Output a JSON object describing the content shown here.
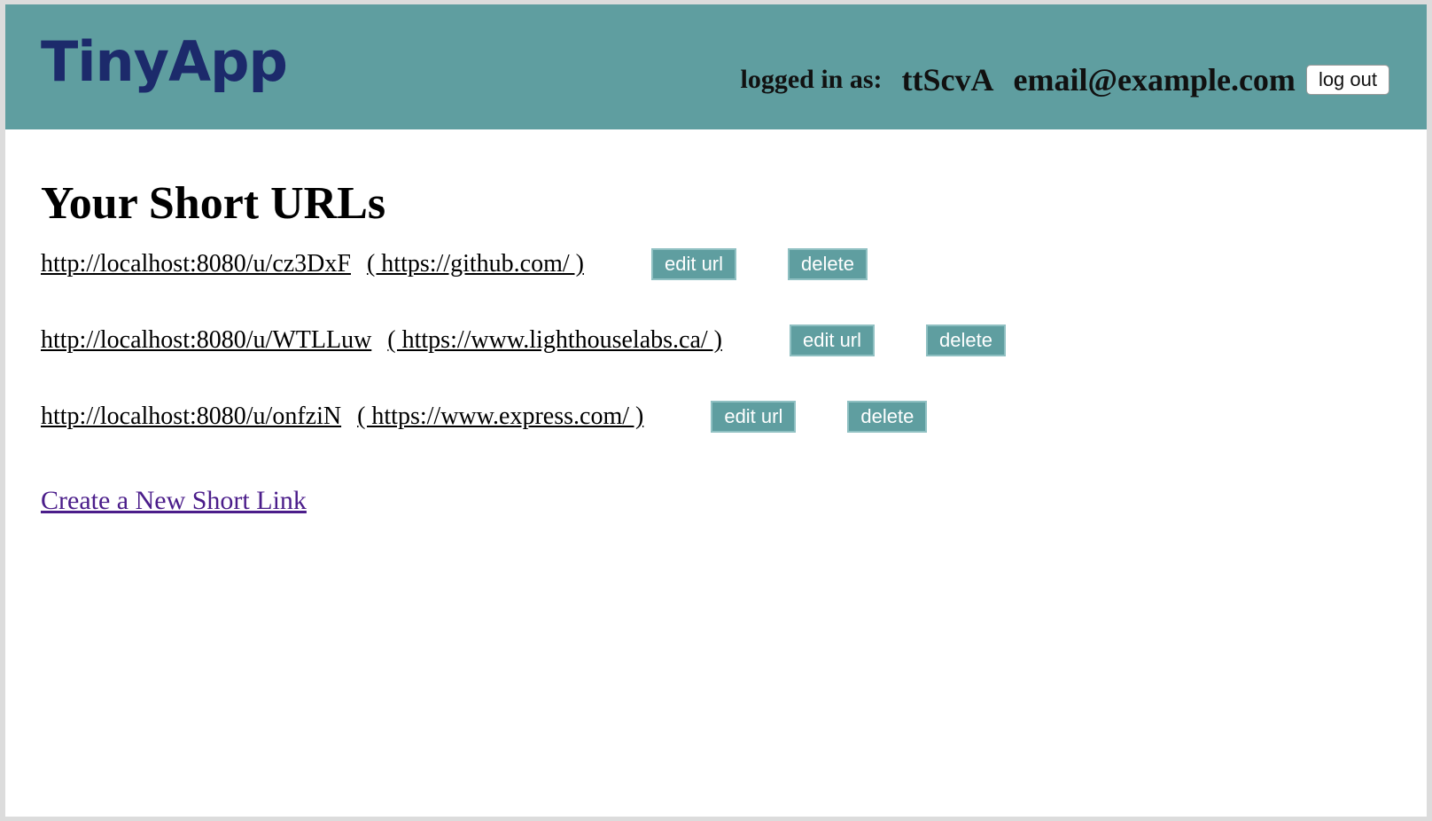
{
  "header": {
    "logo_text": "TinyApp",
    "logged_in_label": "logged in as:",
    "user_id": "ttScvA",
    "user_email": "email@example.com",
    "logout_label": "log out",
    "background_color": "#5f9ea0",
    "logo_color": "#1c2a6b"
  },
  "main": {
    "title": "Your Short URLs",
    "urls": [
      {
        "short_url": "http://localhost:8080/u/cz3DxF",
        "long_url": "( https://github.com/ )",
        "edit_label": "edit url",
        "delete_label": "delete"
      },
      {
        "short_url": "http://localhost:8080/u/WTLLuw",
        "long_url": "( https://www.lighthouselabs.ca/ )",
        "edit_label": "edit url",
        "delete_label": "delete"
      },
      {
        "short_url": "http://localhost:8080/u/onfziN",
        "long_url": "( https://www.express.com/ )",
        "edit_label": "edit url",
        "delete_label": "delete"
      }
    ],
    "create_link_label": "Create a New Short Link",
    "create_link_color": "#4b1d8a",
    "button_color": "#5f9ea0"
  }
}
